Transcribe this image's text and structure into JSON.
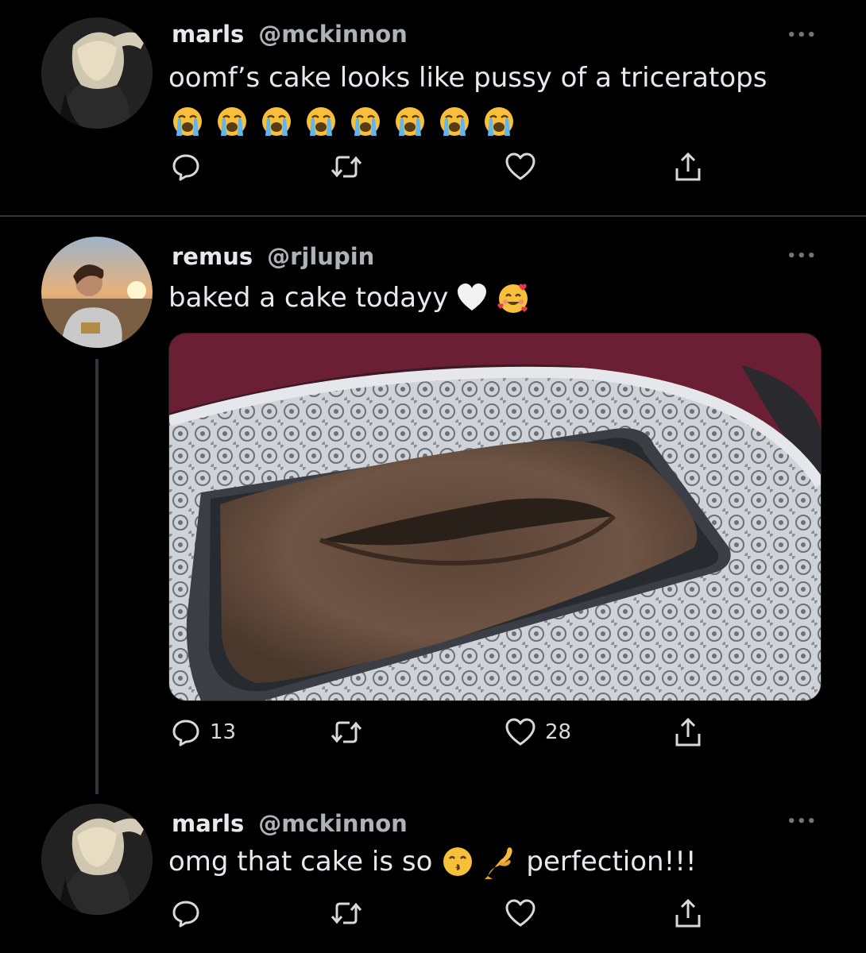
{
  "tweets": [
    {
      "display_name": "marls",
      "handle": "@mckinnon",
      "text": "oomf’s cake looks like pussy of a triceratops",
      "emoji_row": [
        "loudly-crying-face",
        "loudly-crying-face",
        "loudly-crying-face",
        "loudly-crying-face",
        "loudly-crying-face",
        "loudly-crying-face",
        "loudly-crying-face",
        "loudly-crying-face"
      ],
      "more": "•••",
      "replies": "",
      "likes": ""
    },
    {
      "display_name": "remus",
      "handle": "@rjlupin",
      "text": "baked a cake todayy",
      "text_emojis": [
        "white-heart",
        "smiling-face-with-hearts"
      ],
      "more": "•••",
      "replies": "13",
      "likes": "28"
    },
    {
      "display_name": "marls",
      "handle": "@mckinnon",
      "text_before": "omg that cake is so",
      "text_emojis": [
        "kissing-face-with-smiling-eyes",
        "pinching-hand"
      ],
      "text_after": "perfection!!!",
      "more": "•••",
      "replies": "",
      "likes": ""
    }
  ],
  "icons": {
    "reply": "reply-icon",
    "retweet": "retweet-icon",
    "like": "heart-icon",
    "share": "share-icon"
  },
  "colors": {
    "background": "#000000",
    "text": "#e7e9ea",
    "handle": "#aeb3b8",
    "divider": "#2f3336"
  }
}
